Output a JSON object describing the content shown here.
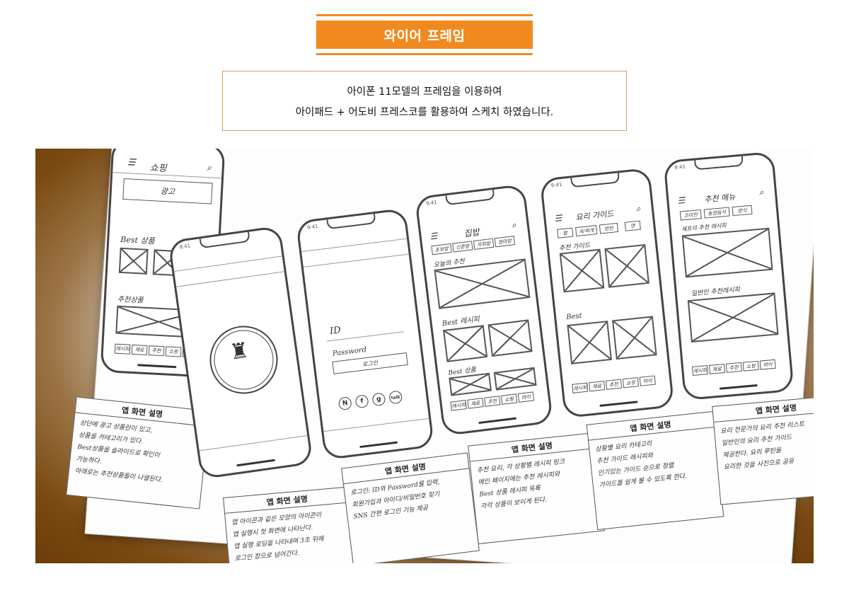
{
  "header": {
    "title": "와이어 프레임"
  },
  "description": {
    "line1": "아이폰 11모델의 프레임을 이용하여",
    "line2": "아이패드 + 어도비 프레스코를 활용하여 스케치 하였습니다."
  },
  "showcase": {
    "card_title": "앱 화면 설명",
    "phone_time": "9:41",
    "shopping": {
      "title": "쇼핑",
      "ad": "광고",
      "best": "Best 상품",
      "recommend": "추천상품"
    },
    "login": {
      "id": "ID",
      "password": "Password",
      "login_button": "로그인"
    },
    "home": {
      "title": "집밥",
      "tabs": [
        "초보방",
        "신혼방",
        "자취방",
        "엄마방"
      ],
      "today": "오늘의 추천",
      "best_recipe": "Best 레시피",
      "best_product": "Best 상품"
    },
    "guide": {
      "title": "요리 가이드",
      "tabs": [
        "밥",
        "국/찌개",
        "반찬",
        "면"
      ],
      "recommend_guide": "추천 가이드",
      "best": "Best"
    },
    "menu": {
      "title": "추천 메뉴",
      "tabs": [
        "코리안",
        "동양음식",
        "양식"
      ],
      "chef": "셰프의 추천 레시피",
      "general": "일반인 추천레시피"
    },
    "bottom_tabs": [
      "레시피",
      "재료",
      "추천",
      "쇼핑",
      "마이"
    ],
    "cards": [
      {
        "lines": [
          "상단에 광고 상품란이 있고,",
          "상품을 카테고리가 있다.",
          "Best상품을 슬라이드로 확인이",
          "가능하다.",
          "아래로는 추천상품들이 나열된다."
        ]
      },
      {
        "lines": [
          "앱 아이콘과 같은 모양의 아이콘이",
          "앱 실행시 첫 화면에 나타난다.",
          "앱 실행 로딩을 나타내며 3초 뒤에",
          "로그인 창으로 넘어간다."
        ]
      },
      {
        "lines": [
          "로그인: ID와 Password를 입력,",
          "회원가입과 아이디/비밀번호 찾기",
          "SNS 간편 로그인 기능 제공"
        ]
      },
      {
        "lines": [
          "추천 요리, 각 상황별 레시피 링크",
          "메인 페이지에는 추천 레시피와",
          "Best 상품 레시피 목록",
          "각각 상품이 보이게 된다."
        ]
      },
      {
        "lines": [
          "상황별 요리 카테고리",
          "추천 가이드 레시피와",
          "인기있는 가이드 순으로 정렬",
          "가이드를 쉽게 볼 수 있도록 한다."
        ]
      },
      {
        "lines": [
          "요리 전문가의 요리 추천 리스트",
          "일반인의 요리 추천 가이드",
          "제공한다. 요리 루틴을",
          "요리한 것을 사진으로 공유"
        ]
      }
    ]
  }
}
